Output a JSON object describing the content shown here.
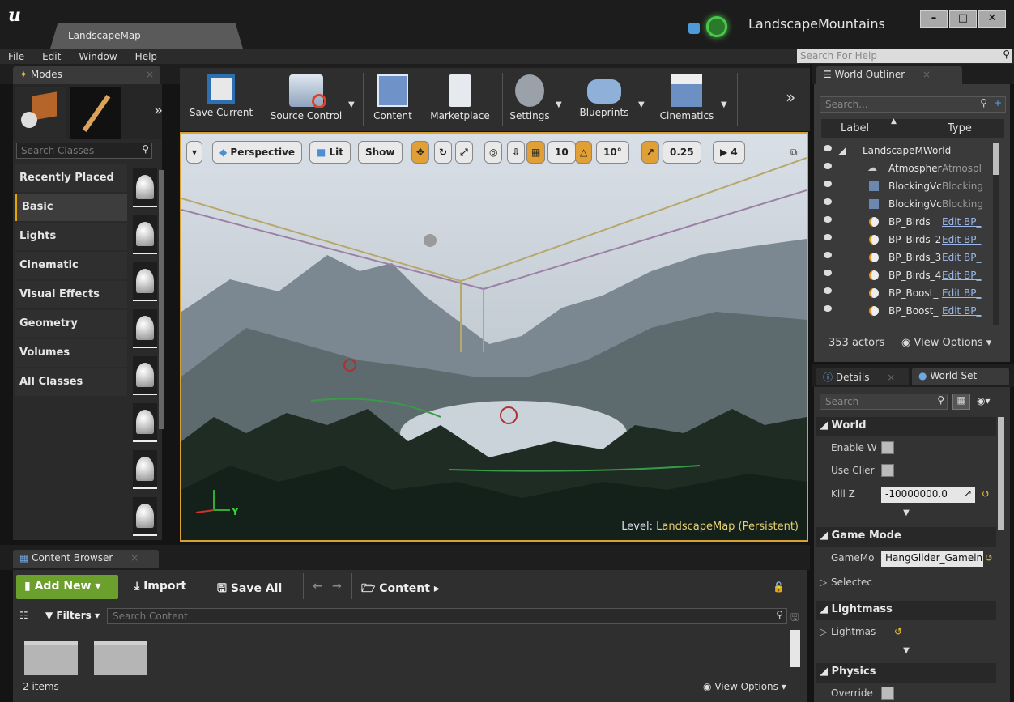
{
  "app": {
    "map_tab": "LandscapeMap",
    "project_name": "LandscapeMountains",
    "window_buttons": [
      "–",
      "□",
      "✕"
    ]
  },
  "menu": {
    "items": [
      "File",
      "Edit",
      "Window",
      "Help"
    ],
    "help_search_placeholder": "Search For Help"
  },
  "modes": {
    "tab_label": "Modes",
    "search_placeholder": "Search Classes",
    "categories": [
      "Recently Placed",
      "Basic",
      "Lights",
      "Cinematic",
      "Visual Effects",
      "Geometry",
      "Volumes",
      "All Classes"
    ],
    "active_category": "Basic"
  },
  "toolbar": {
    "buttons": [
      "Save Current",
      "Source Control",
      "Content",
      "Marketplace",
      "Settings",
      "Blueprints",
      "Cinematics"
    ],
    "more": "»"
  },
  "viewport": {
    "view_mode": "Perspective",
    "lighting": "Lit",
    "show": "Show",
    "grid_snap": "10",
    "rotation_snap": "10°",
    "scale_snap": "0.25",
    "camera_speed": "4",
    "level_prefix": "Level:",
    "level_name": "LandscapeMap (Persistent)",
    "axis_y": "Y"
  },
  "outliner": {
    "tab_label": "World Outliner",
    "search_placeholder": "Search...",
    "col_label": "Label",
    "col_type": "Type",
    "rows": [
      {
        "label": "LandscapeMWorld",
        "type": ""
      },
      {
        "label": "Atmospher",
        "type": "Atmospl"
      },
      {
        "label": "BlockingVc",
        "type": "Blocking"
      },
      {
        "label": "BlockingVc",
        "type": "Blocking"
      },
      {
        "label": "BP_Birds",
        "type": "Edit BP_"
      },
      {
        "label": "BP_Birds_2",
        "type": "Edit BP_"
      },
      {
        "label": "BP_Birds_3",
        "type": "Edit BP_"
      },
      {
        "label": "BP_Birds_4",
        "type": "Edit BP_"
      },
      {
        "label": "BP_Boost_",
        "type": "Edit BP_"
      },
      {
        "label": "BP_Boost_",
        "type": "Edit BP_"
      }
    ],
    "actor_count": "353 actors",
    "view_options": "View Options"
  },
  "details": {
    "tab_details": "Details",
    "tab_world_settings": "World Set",
    "search_placeholder": "Search",
    "sections": {
      "world": "World",
      "game_mode": "Game Mode",
      "lightmass": "Lightmass",
      "physics": "Physics"
    },
    "props": {
      "enable_w": "Enable W",
      "use_clier": "Use Clier",
      "kill_z": "Kill Z",
      "kill_z_value": "-10000000.0",
      "gamemo": "GameMo",
      "gamemode_value": "HangGlider_Gamein",
      "selected": "Selectec",
      "lightmas": "Lightmas",
      "override": "Override"
    }
  },
  "content_browser": {
    "tab_label": "Content Browser",
    "add_new": "Add New",
    "import": "Import",
    "save_all": "Save All",
    "path": "Content",
    "filters": "Filters",
    "search_placeholder": "Search Content",
    "item_count": "2 items",
    "view_options": "View Options"
  }
}
